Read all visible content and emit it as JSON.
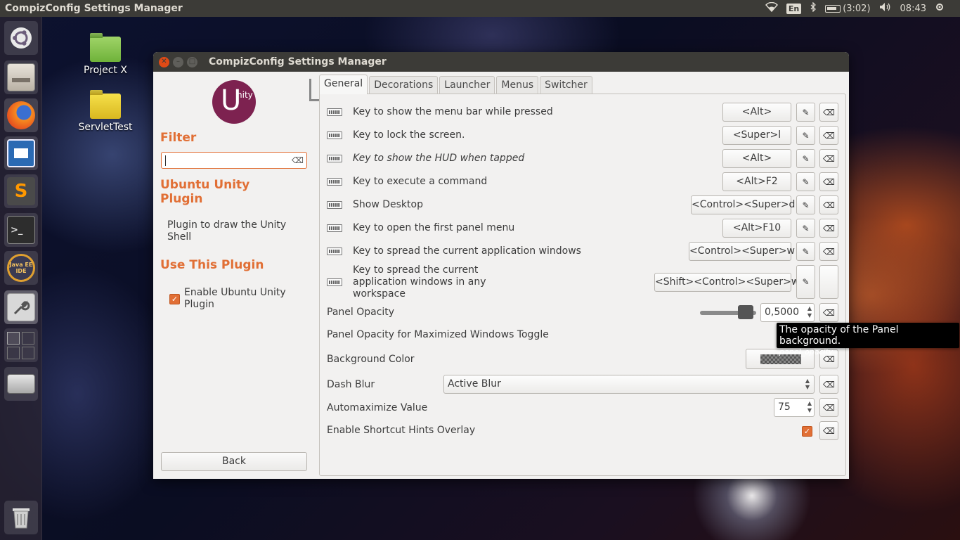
{
  "top_panel": {
    "title": "CompizConfig Settings Manager",
    "lang": "En",
    "battery": "(3:02)",
    "time": "08:43"
  },
  "desktop": {
    "icons": [
      {
        "label": "Project X"
      },
      {
        "label": "ServletTest"
      }
    ]
  },
  "launcher": {
    "items": [
      {
        "name": "ubuntu-dash-icon"
      },
      {
        "name": "files-icon"
      },
      {
        "name": "firefox-icon"
      },
      {
        "name": "libreoffice-impress-icon"
      },
      {
        "name": "sublime-text-icon",
        "glyph": "S"
      },
      {
        "name": "terminal-icon",
        "glyph": ">_"
      },
      {
        "name": "java-ee-ide-icon",
        "glyph": "Java EE IDE"
      },
      {
        "name": "settings-manager-icon"
      },
      {
        "name": "workspace-switcher-icon"
      },
      {
        "name": "drive-icon"
      },
      {
        "name": "trash-icon"
      }
    ]
  },
  "window": {
    "title": "CompizConfig Settings Manager",
    "sidebar": {
      "logo_u": "U",
      "logo_text": "nity",
      "filter_heading": "Filter",
      "filter_value": "",
      "plugin_heading": "Ubuntu Unity Plugin",
      "plugin_description": "Plugin to draw the Unity Shell",
      "use_heading": "Use This Plugin",
      "enable_label": "Enable Ubuntu Unity Plugin",
      "enable_checked": true,
      "back_label": "Back"
    },
    "tabs": [
      {
        "label": "General",
        "active": true
      },
      {
        "label": "Decorations"
      },
      {
        "label": "Launcher"
      },
      {
        "label": "Menus"
      },
      {
        "label": "Switcher"
      }
    ],
    "settings": {
      "shortcuts": [
        {
          "label": "Key to show the menu bar while pressed",
          "value": "<Alt>"
        },
        {
          "label": "Key to lock the screen.",
          "value": "<Super>l"
        },
        {
          "label": "Key to show the HUD when tapped",
          "value": "<Alt>"
        },
        {
          "label": "Key to execute a command",
          "value": "<Alt>F2"
        },
        {
          "label": "Show Desktop",
          "value": "<Control><Super>d"
        },
        {
          "label": "Key to open the first panel menu",
          "value": "<Alt>F10"
        },
        {
          "label": "Key to spread the current application windows",
          "value": "<Control><Super>w"
        },
        {
          "label": "Key to spread the current application windows in any workspace",
          "value": "<Shift><Control><Super>w"
        }
      ],
      "panel_opacity": {
        "label": "Panel Opacity",
        "value": "0,5000",
        "level": 0.5
      },
      "panel_opacity_max": {
        "label": "Panel Opacity for Maximized Windows Toggle"
      },
      "background_color": {
        "label": "Background Color"
      },
      "dash_blur": {
        "label": "Dash Blur",
        "value": "Active Blur"
      },
      "automaximize": {
        "label": "Automaximize Value",
        "value": "75"
      },
      "shortcut_hints": {
        "label": "Enable Shortcut Hints Overlay",
        "checked": true
      }
    },
    "tooltip": {
      "text": "The opacity of the Panel background.",
      "key": "panel_opacity"
    }
  },
  "colors": {
    "accent": "#e16f35",
    "panel_bg": "#3c3b37",
    "window_bg": "#f2f1f0",
    "close_button": "#df4a16"
  }
}
